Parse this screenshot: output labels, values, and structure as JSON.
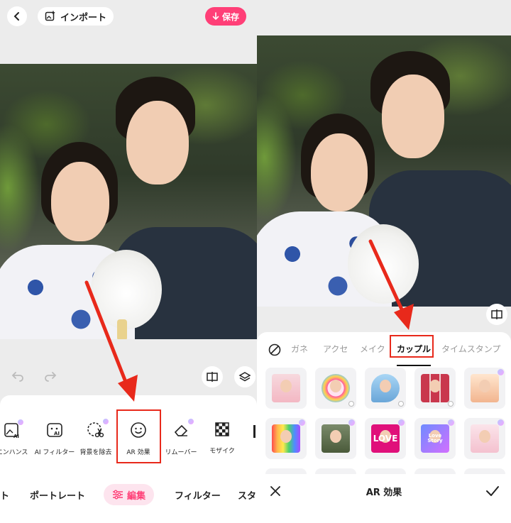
{
  "left": {
    "import_label": "インポート",
    "save_label": "保存",
    "tools": [
      {
        "label": "エンハンス"
      },
      {
        "label": "AI フィルター"
      },
      {
        "label": "背景を除去"
      },
      {
        "label": "AR 効果"
      },
      {
        "label": "リムーバー"
      },
      {
        "label": "モザイク"
      }
    ],
    "nav": {
      "partial_left": "ト",
      "portrait": "ポートレート",
      "edit": "編集",
      "filter": "フィルター",
      "partial_right": "スタ"
    }
  },
  "right": {
    "tabs": [
      {
        "label": "ガネ"
      },
      {
        "label": "アクセ"
      },
      {
        "label": "メイク"
      },
      {
        "label": "カップル"
      },
      {
        "label": "タイムスタンプ"
      }
    ],
    "effects": {
      "love_text": "LOVE",
      "love_story_text": "Love Story"
    },
    "bottom_title": "AR 効果"
  },
  "colors": {
    "accent": "#ff3f77",
    "highlight": "#e8291b",
    "premium": "#c9a4ff"
  }
}
